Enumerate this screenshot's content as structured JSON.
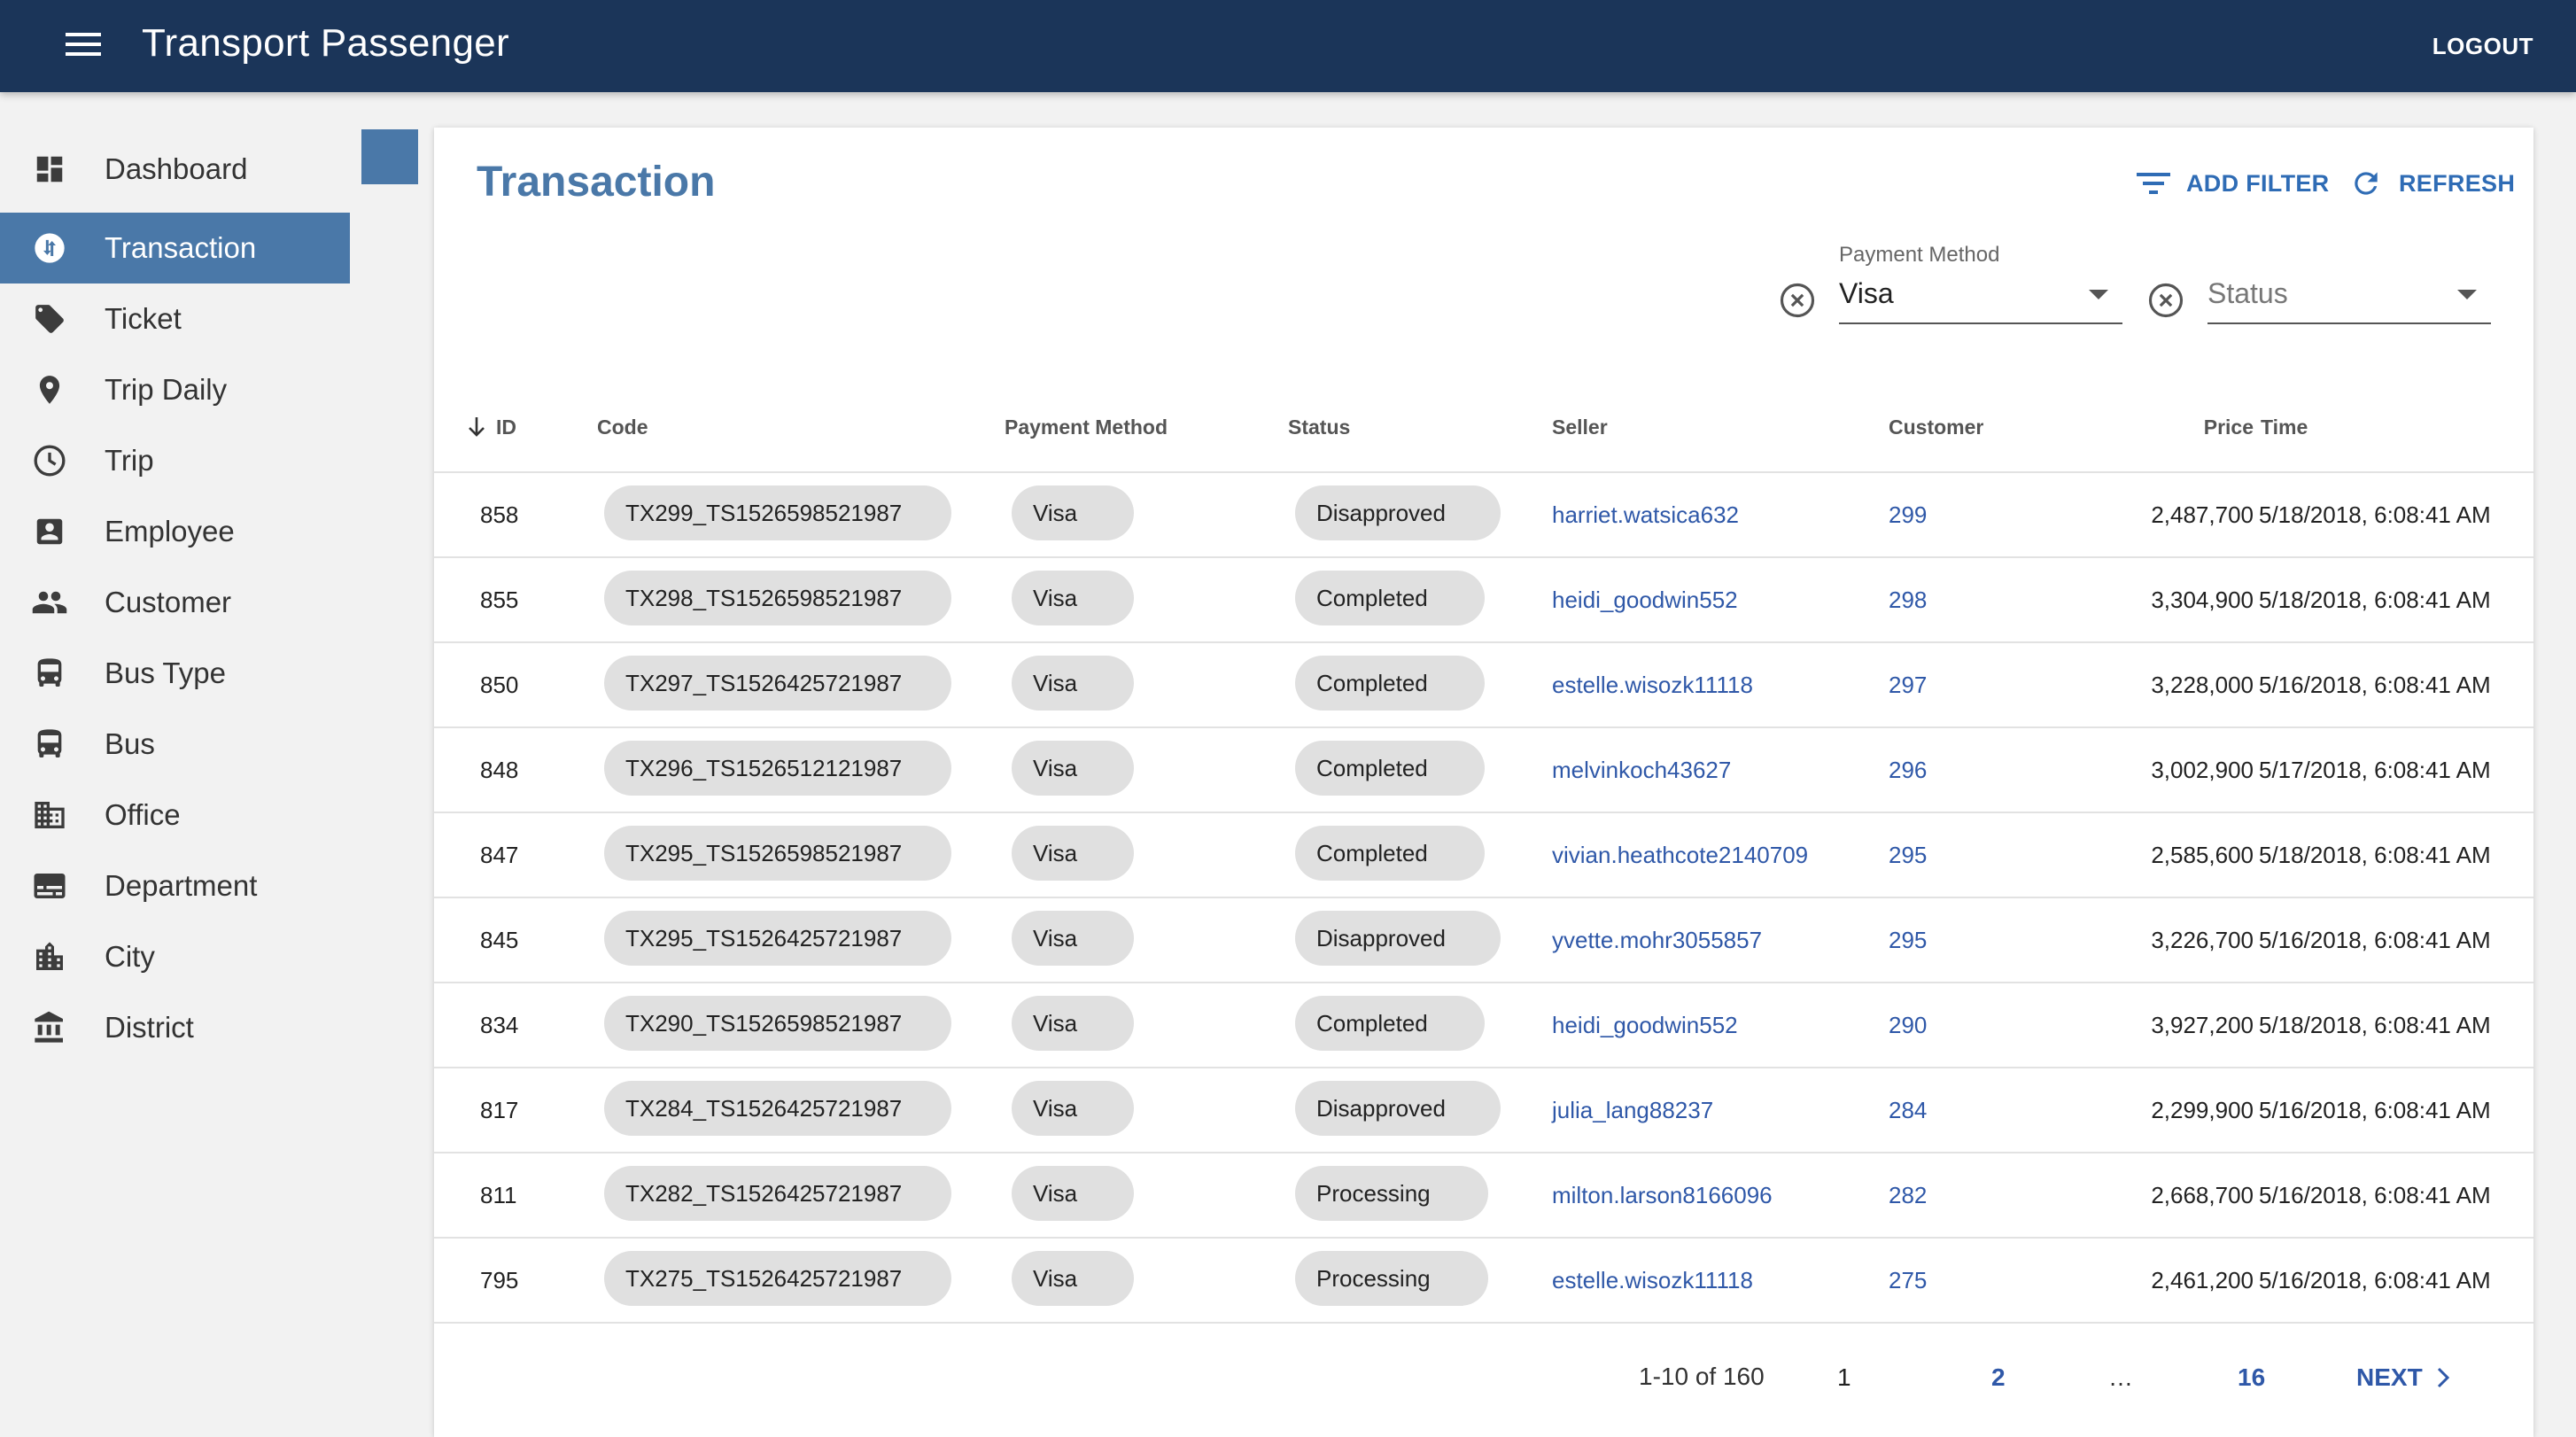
{
  "app": {
    "title": "Transport Passenger",
    "logout_label": "LOGOUT"
  },
  "sidebar": {
    "items": [
      {
        "label": "Dashboard",
        "icon": "dashboard-icon"
      },
      {
        "label": "Transaction",
        "icon": "swap-icon",
        "active": true
      },
      {
        "label": "Ticket",
        "icon": "tag-icon"
      },
      {
        "label": "Trip Daily",
        "icon": "pin-icon"
      },
      {
        "label": "Trip",
        "icon": "clock-icon"
      },
      {
        "label": "Employee",
        "icon": "account-box-icon"
      },
      {
        "label": "Customer",
        "icon": "people-icon"
      },
      {
        "label": "Bus Type",
        "icon": "bus-icon"
      },
      {
        "label": "Bus",
        "icon": "bus-icon"
      },
      {
        "label": "Office",
        "icon": "building-icon"
      },
      {
        "label": "Department",
        "icon": "card-icon"
      },
      {
        "label": "City",
        "icon": "city-icon"
      },
      {
        "label": "District",
        "icon": "bank-icon"
      }
    ]
  },
  "main": {
    "title": "Transaction",
    "add_filter_label": "ADD FILTER",
    "refresh_label": "REFRESH",
    "filters": {
      "payment_method": {
        "label": "Payment Method",
        "value": "Visa"
      },
      "status": {
        "placeholder": "Status"
      }
    },
    "table": {
      "headers": [
        "ID",
        "Code",
        "Payment Method",
        "Status",
        "Seller",
        "Customer",
        "Price",
        "Time"
      ],
      "rows": [
        {
          "id": "858",
          "code": "TX299_TS1526598521987",
          "payment": "Visa",
          "status": "Disapproved",
          "seller": "harriet.watsica632",
          "customer": "299",
          "price": "2,487,700",
          "time": "5/18/2018, 6:08:41 AM"
        },
        {
          "id": "855",
          "code": "TX298_TS1526598521987",
          "payment": "Visa",
          "status": "Completed",
          "seller": "heidi_goodwin552",
          "customer": "298",
          "price": "3,304,900",
          "time": "5/18/2018, 6:08:41 AM"
        },
        {
          "id": "850",
          "code": "TX297_TS1526425721987",
          "payment": "Visa",
          "status": "Completed",
          "seller": "estelle.wisozk11118",
          "customer": "297",
          "price": "3,228,000",
          "time": "5/16/2018, 6:08:41 AM"
        },
        {
          "id": "848",
          "code": "TX296_TS1526512121987",
          "payment": "Visa",
          "status": "Completed",
          "seller": "melvinkoch43627",
          "customer": "296",
          "price": "3,002,900",
          "time": "5/17/2018, 6:08:41 AM"
        },
        {
          "id": "847",
          "code": "TX295_TS1526598521987",
          "payment": "Visa",
          "status": "Completed",
          "seller": "vivian.heathcote2140709",
          "customer": "295",
          "price": "2,585,600",
          "time": "5/18/2018, 6:08:41 AM"
        },
        {
          "id": "845",
          "code": "TX295_TS1526425721987",
          "payment": "Visa",
          "status": "Disapproved",
          "seller": "yvette.mohr3055857",
          "customer": "295",
          "price": "3,226,700",
          "time": "5/16/2018, 6:08:41 AM"
        },
        {
          "id": "834",
          "code": "TX290_TS1526598521987",
          "payment": "Visa",
          "status": "Completed",
          "seller": "heidi_goodwin552",
          "customer": "290",
          "price": "3,927,200",
          "time": "5/18/2018, 6:08:41 AM"
        },
        {
          "id": "817",
          "code": "TX284_TS1526425721987",
          "payment": "Visa",
          "status": "Disapproved",
          "seller": "julia_lang88237",
          "customer": "284",
          "price": "2,299,900",
          "time": "5/16/2018, 6:08:41 AM"
        },
        {
          "id": "811",
          "code": "TX282_TS1526425721987",
          "payment": "Visa",
          "status": "Processing",
          "seller": "milton.larson8166096",
          "customer": "282",
          "price": "2,668,700",
          "time": "5/16/2018, 6:08:41 AM"
        },
        {
          "id": "795",
          "code": "TX275_TS1526425721987",
          "payment": "Visa",
          "status": "Processing",
          "seller": "estelle.wisozk11118",
          "customer": "275",
          "price": "2,461,200",
          "time": "5/16/2018, 6:08:41 AM"
        }
      ]
    },
    "pagination": {
      "range": "1-10 of 160",
      "pages": [
        "1",
        "2",
        "…",
        "16"
      ],
      "next_label": "NEXT"
    }
  },
  "colors": {
    "appbar": "#1b3559",
    "accent": "#4a78a8",
    "link": "#2f58a8"
  }
}
